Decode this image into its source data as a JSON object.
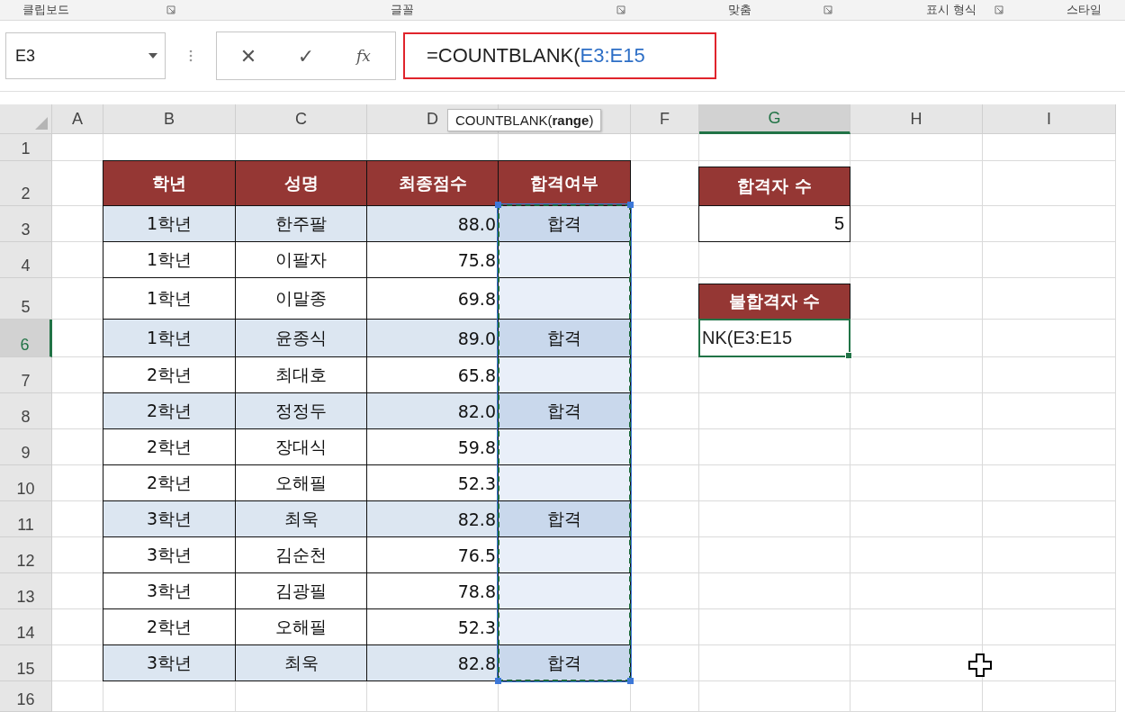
{
  "ribbon_groups": [
    {
      "label": "클립보드",
      "launcher": true
    },
    {
      "label": "글꼴",
      "launcher": true
    },
    {
      "label": "맞춤",
      "launcher": true
    },
    {
      "label": "표시 형식",
      "launcher": true
    },
    {
      "label": "스타일",
      "launcher": false
    }
  ],
  "formula_bar": {
    "name_box": "E3",
    "cancel": "✕",
    "enter": "✓",
    "function": "fx",
    "formula_prefix": "=COUNTBLANK(",
    "formula_ref": "E3:E15",
    "tooltip": "COUNTBLANK(**range**)"
  },
  "columns": [
    {
      "label": "A",
      "selected": false
    },
    {
      "label": "B",
      "selected": false
    },
    {
      "label": "C",
      "selected": false
    },
    {
      "label": "D",
      "selected": false
    },
    {
      "selected": false
    },
    {
      "label": "F",
      "selected": false
    },
    {
      "label": "G",
      "selected": true
    },
    {
      "label": "H",
      "selected": false
    },
    {
      "label": "I",
      "selected": false
    }
  ],
  "rows": [
    {
      "label": "1",
      "selected": false
    },
    {
      "label": "2",
      "selected": false
    },
    {
      "label": "3",
      "selected": false
    },
    {
      "label": "4",
      "selected": false
    },
    {
      "label": "5",
      "selected": false
    },
    {
      "label": "6",
      "selected": true
    },
    {
      "label": "7",
      "selected": false
    },
    {
      "label": "8",
      "selected": false
    },
    {
      "label": "9",
      "selected": false
    },
    {
      "label": "10",
      "selected": false
    },
    {
      "label": "11",
      "selected": false
    },
    {
      "label": "12",
      "selected": false
    },
    {
      "label": "13",
      "selected": false
    },
    {
      "label": "14",
      "selected": false
    },
    {
      "label": "15",
      "selected": false
    },
    {
      "label": "16",
      "selected": false
    }
  ],
  "table": {
    "headers": [
      "학년",
      "성명",
      "최종점수",
      "합격여부"
    ],
    "records": [
      {
        "grade": "1학년",
        "name": "한주팔",
        "score": "88.0",
        "result": "합격",
        "highlighted": true
      },
      {
        "grade": "1학년",
        "name": "이팔자",
        "score": "75.8",
        "highlighted": false
      },
      {
        "grade": "1학년",
        "name": "이말종",
        "score": "69.8",
        "highlighted": false
      },
      {
        "grade": "1학년",
        "name": "윤종식",
        "score": "89.0",
        "result": "합격",
        "highlighted": true
      },
      {
        "grade": "2학년",
        "name": "최대호",
        "score": "65.8",
        "highlighted": false
      },
      {
        "grade": "2학년",
        "name": "정정두",
        "score": "82.0",
        "result": "합격",
        "highlighted": true
      },
      {
        "grade": "2학년",
        "name": "장대식",
        "score": "59.8",
        "highlighted": false
      },
      {
        "grade": "2학년",
        "name": "오해필",
        "score": "52.3",
        "highlighted": false
      },
      {
        "grade": "3학년",
        "name": "최욱",
        "score": "82.8",
        "result": "합격",
        "highlighted": true
      },
      {
        "grade": "3학년",
        "name": "김순천",
        "score": "76.5",
        "highlighted": false
      },
      {
        "grade": "3학년",
        "name": "김광필",
        "score": "78.8",
        "highlighted": false
      },
      {
        "grade": "2학년",
        "name": "오해필",
        "score": "52.3",
        "highlighted": false
      },
      {
        "grade": "3학년",
        "name": "최욱",
        "score": "82.8",
        "result": "합격",
        "highlighted": true
      }
    ]
  },
  "summary": {
    "passed_label": "합격자 수",
    "passed_value": "5",
    "failed_label": "불합격자 수",
    "editing_text": "NK(E3:E15"
  }
}
